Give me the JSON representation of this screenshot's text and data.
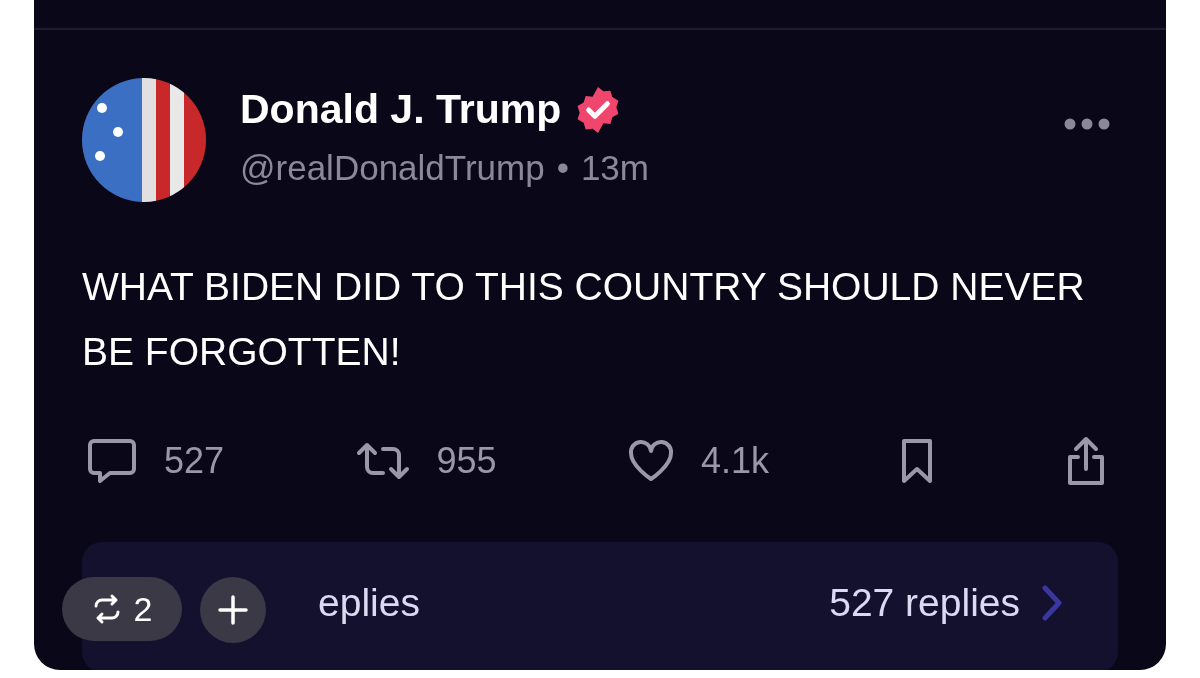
{
  "post": {
    "author": "Donald J. Trump",
    "verified": true,
    "handle": "@realDonaldTrump",
    "separator": "•",
    "time": "13m",
    "text": "WHAT BIDEN DID TO THIS COUNTRY SHOULD NEVER BE FORGOTTEN!",
    "actions": [
      {
        "kind": "reply",
        "count": "527"
      },
      {
        "kind": "repost",
        "count": "955"
      },
      {
        "kind": "like",
        "count": "4.1k"
      },
      {
        "kind": "bookmark"
      },
      {
        "kind": "share"
      }
    ]
  },
  "replies_bar": {
    "label": "eplies",
    "count": "527 replies"
  },
  "overlay": {
    "repost_count": "2"
  }
}
